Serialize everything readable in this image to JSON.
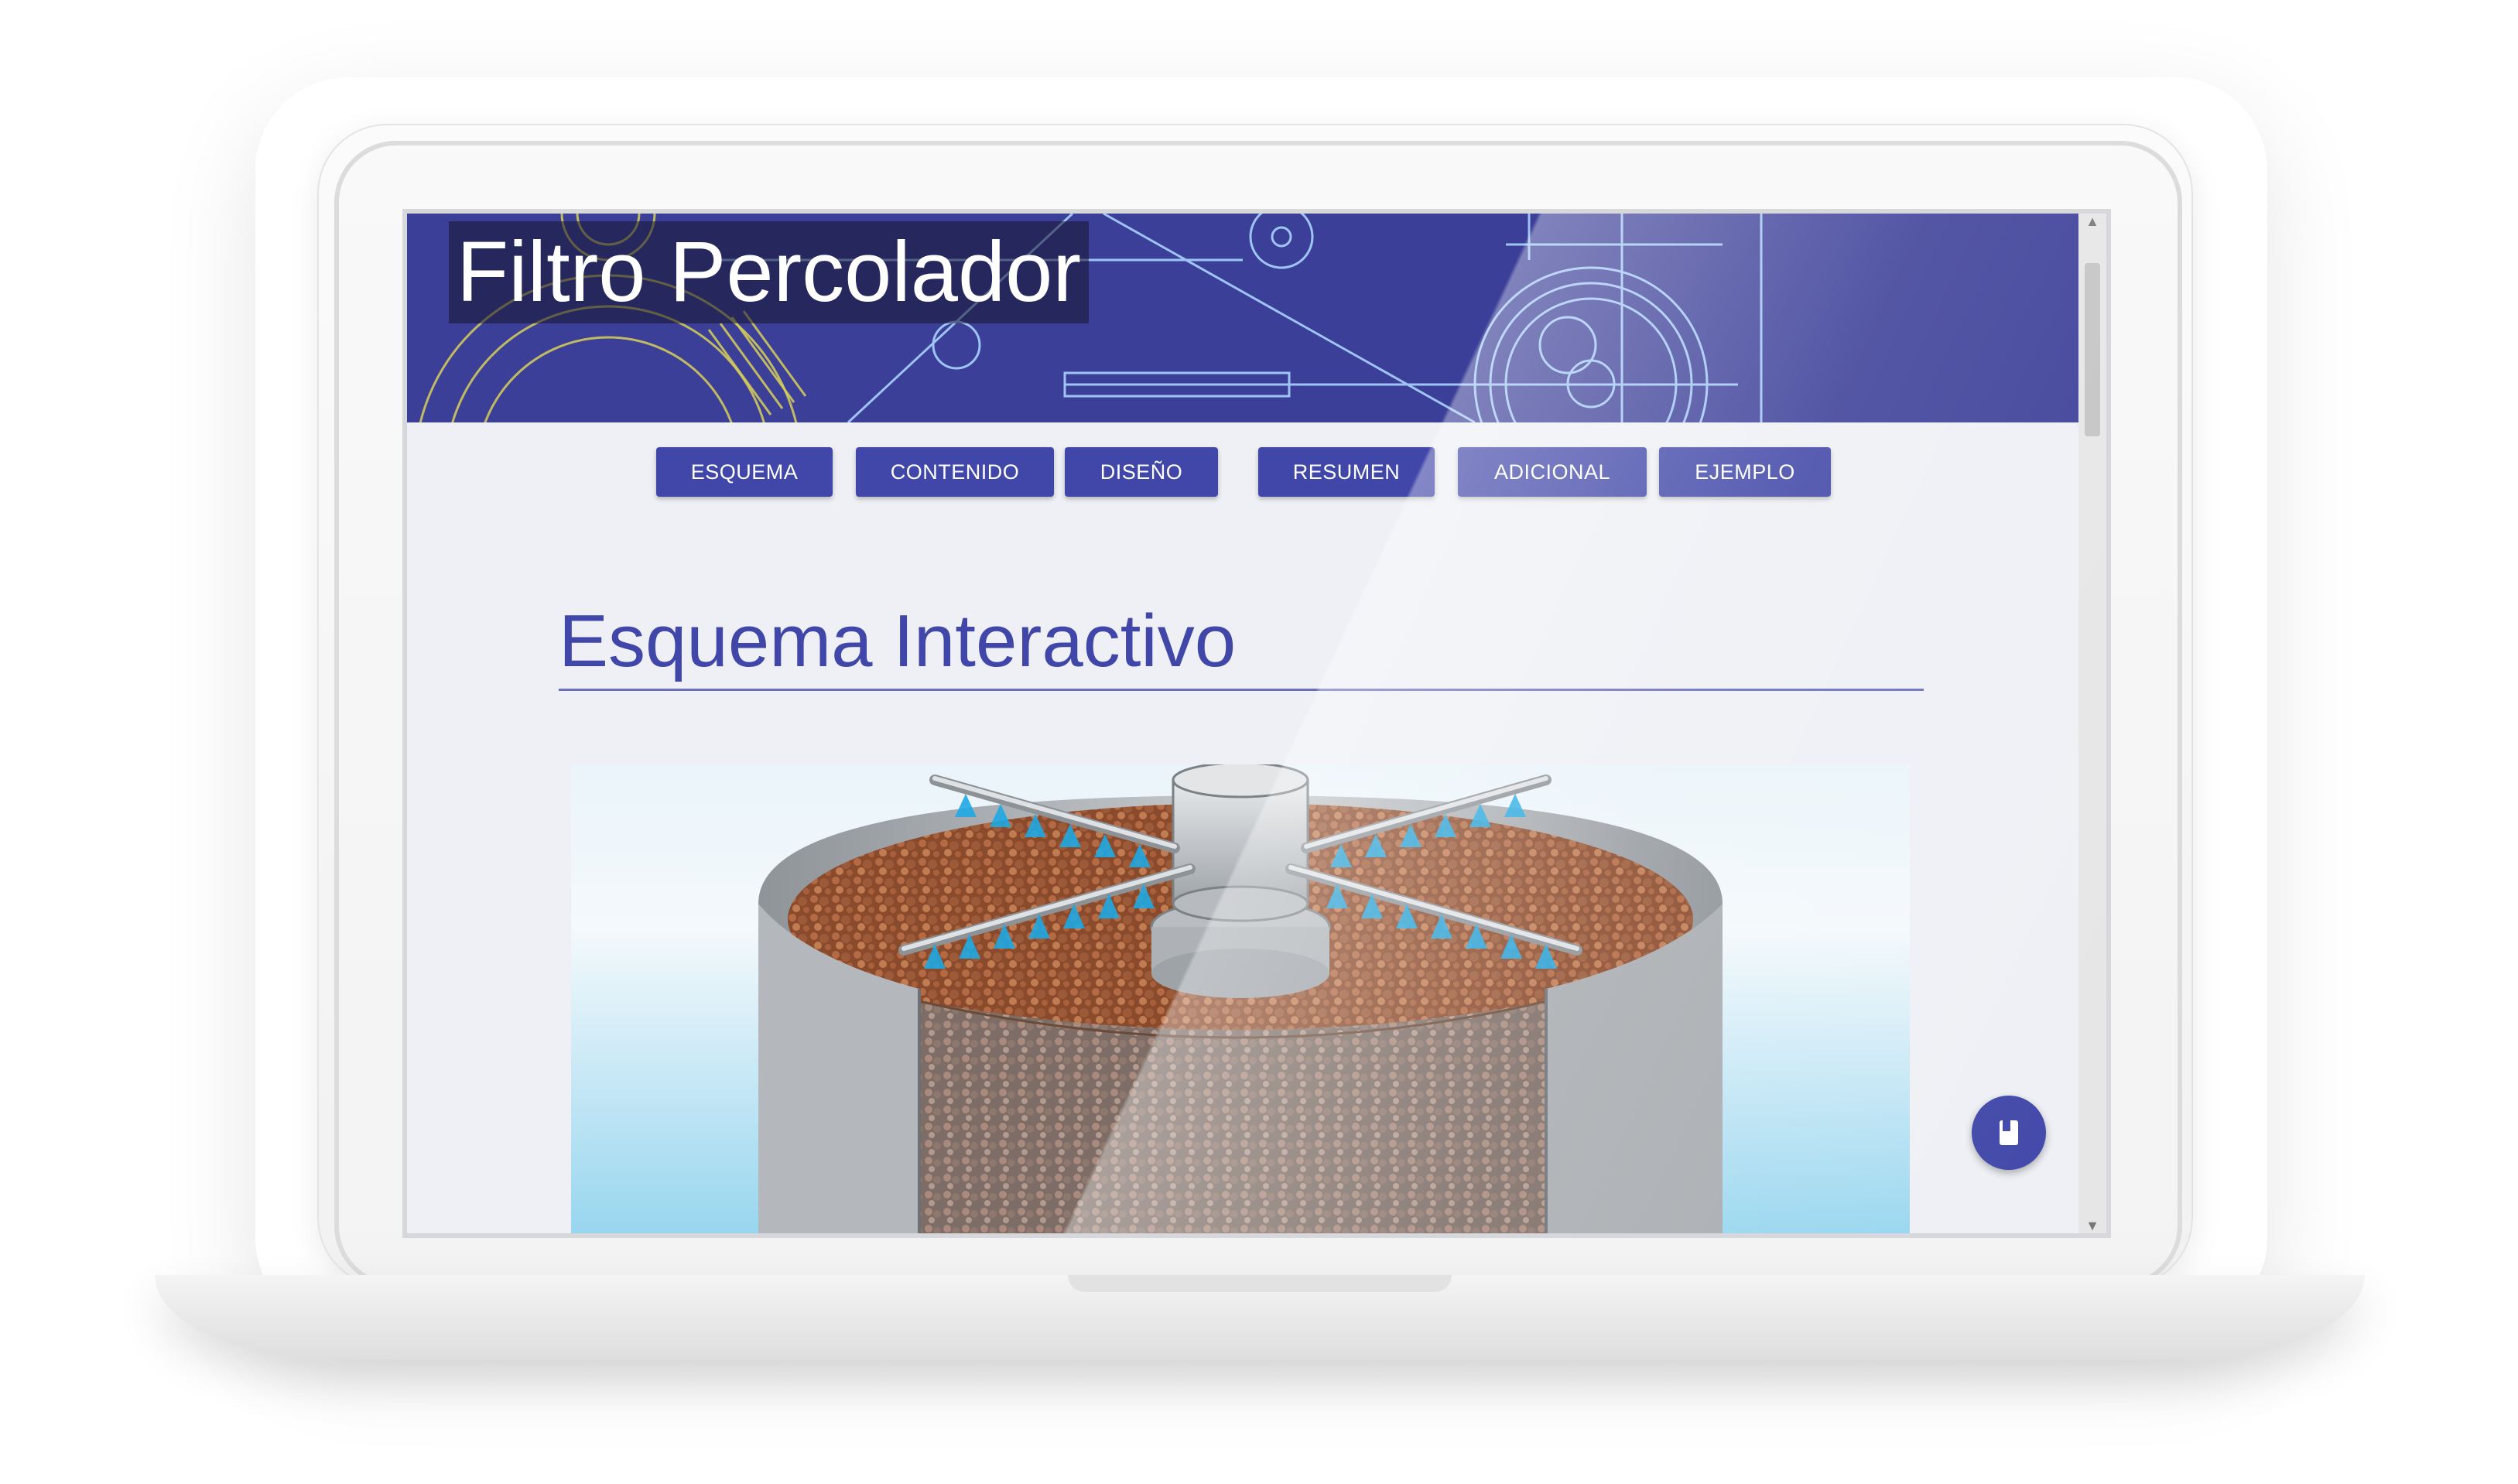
{
  "header": {
    "title": "Filtro Percolador"
  },
  "nav": {
    "items": [
      {
        "label": "ESQUEMA"
      },
      {
        "label": "CONTENIDO"
      },
      {
        "label": "DISEÑO"
      },
      {
        "label": "RESUMEN"
      },
      {
        "label": "ADICIONAL"
      },
      {
        "label": "EJEMPLO"
      }
    ]
  },
  "main": {
    "heading": "Esquema Interactivo"
  },
  "icons": {
    "fab": "book-icon",
    "scroll_up": "arrow-up-icon",
    "scroll_down": "arrow-down-icon"
  },
  "colors": {
    "accent": "#4147a8",
    "banner": "#3c3f98",
    "page_background": "#eef0f5"
  }
}
